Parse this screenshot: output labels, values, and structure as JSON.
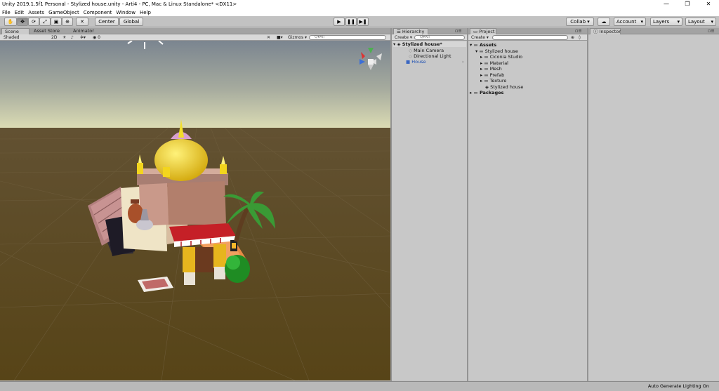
{
  "window": {
    "title": "Unity 2019.1.5f1 Personal - Stylized house.unity - Arti4 - PC, Mac & Linux Standalone* <DX11>",
    "controls": [
      "—",
      "❐",
      "✕"
    ]
  },
  "menu": [
    "File",
    "Edit",
    "Assets",
    "GameObject",
    "Component",
    "Window",
    "Help"
  ],
  "toolbar": {
    "tools": [
      {
        "name": "hand-tool",
        "glyph": "✋"
      },
      {
        "name": "move-tool",
        "glyph": "✥"
      },
      {
        "name": "rotate-tool",
        "glyph": "⟳"
      },
      {
        "name": "scale-tool",
        "glyph": "⤢"
      },
      {
        "name": "rect-tool",
        "glyph": "▣"
      },
      {
        "name": "transform-tool",
        "glyph": "⊕"
      },
      {
        "name": "custom-tool",
        "glyph": "✕"
      }
    ],
    "pivot": "Center",
    "space": "Global",
    "play": "▶",
    "pause": "❚❚",
    "step": "▶❚",
    "collab": "Collab ▾",
    "account": "Account",
    "layers": "Layers",
    "layout": "Layout"
  },
  "scene_panel": {
    "tabs": [
      "Scene",
      "Asset Store",
      "Animator"
    ],
    "shading": "Shaded",
    "mode_2d": "2D",
    "gizmos": "Gizmos ▾",
    "search": "Q▾All"
  },
  "hierarchy": {
    "tab": "Hierarchy",
    "create": "Create ▾",
    "search": "Q▾All",
    "scene": "Stylized house*",
    "items": [
      "Main Camera",
      "Directional Light",
      "House"
    ]
  },
  "project": {
    "tab": "Project",
    "create": "Create ▾",
    "tree": [
      {
        "label": "Assets",
        "depth": 0,
        "bold": true
      },
      {
        "label": "Stylized house",
        "depth": 1
      },
      {
        "label": "Ciconia Studio",
        "depth": 2
      },
      {
        "label": "Material",
        "depth": 2
      },
      {
        "label": "Mesh",
        "depth": 2
      },
      {
        "label": "Prefab",
        "depth": 2
      },
      {
        "label": "Texture",
        "depth": 2
      },
      {
        "label": "Stylized house",
        "depth": 2
      },
      {
        "label": "Packages",
        "depth": 0,
        "bold": true
      }
    ]
  },
  "inspector": {
    "tab": "Inspector"
  },
  "status": {
    "text": "Auto Generate Lighting On"
  },
  "colors": {
    "ground": "#5b4a1f",
    "sky_top": "#9aa3a6",
    "horizon": "#d9dab2",
    "dome": "#f0d21e",
    "awning": "#c2202a",
    "selection_blue": "#3a66c2"
  }
}
